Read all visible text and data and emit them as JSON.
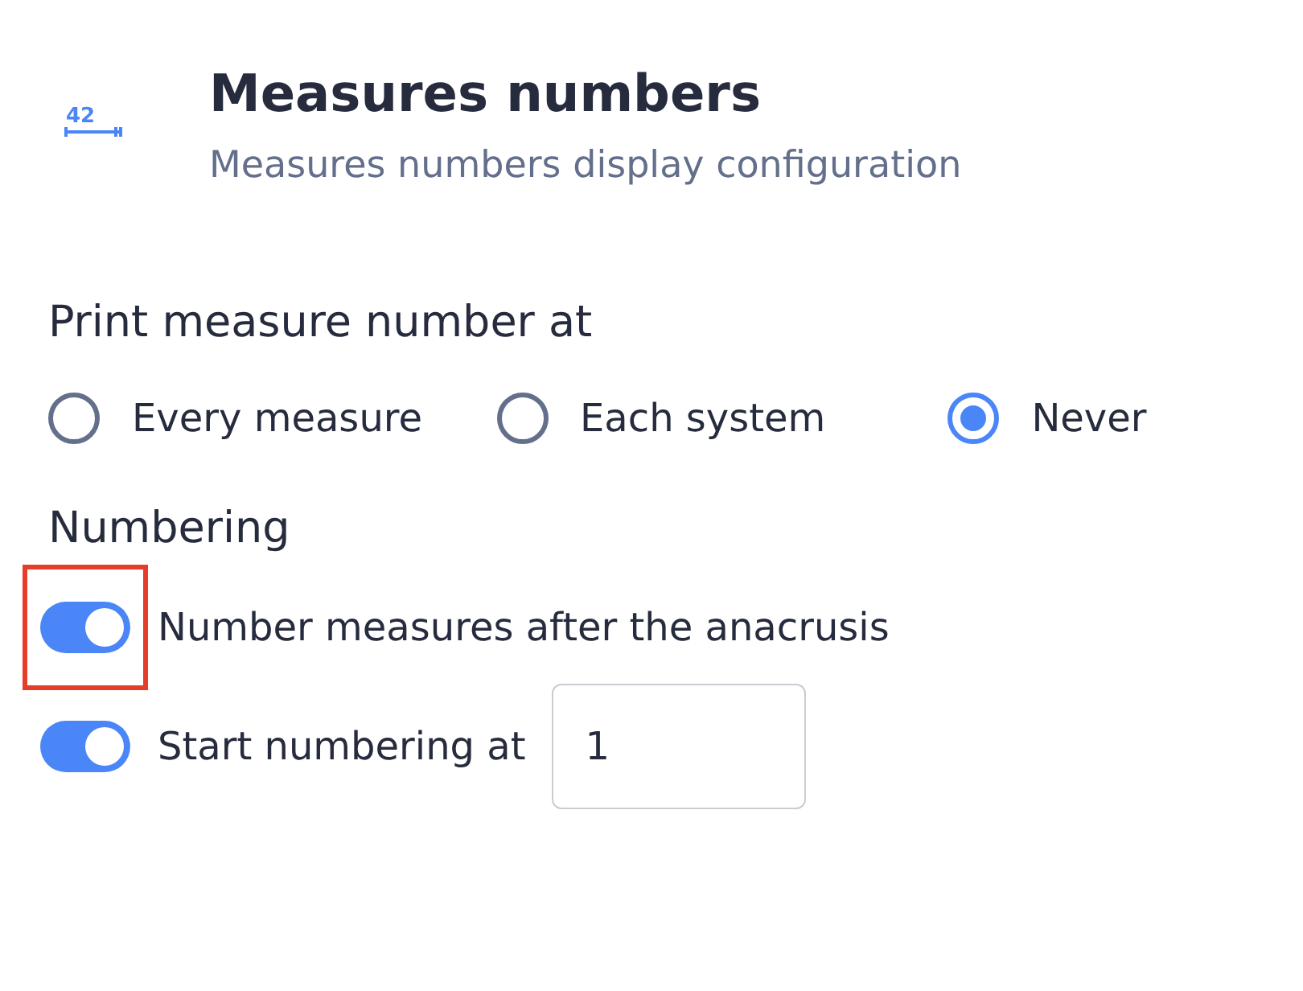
{
  "header": {
    "icon_text": "42",
    "title": "Measures numbers",
    "subtitle": "Measures numbers display configuration"
  },
  "print_section": {
    "heading": "Print measure number at",
    "options": [
      {
        "label": "Every measure",
        "selected": false
      },
      {
        "label": "Each system",
        "selected": false
      },
      {
        "label": "Never",
        "selected": true
      }
    ]
  },
  "numbering": {
    "heading": "Numbering",
    "items": [
      {
        "kind": "toggle",
        "label": "Number measures after the anacrusis",
        "on": true,
        "highlighted": true
      },
      {
        "kind": "toggle_input",
        "label": "Start numbering at",
        "on": true,
        "highlighted": false,
        "value": "1"
      }
    ]
  }
}
